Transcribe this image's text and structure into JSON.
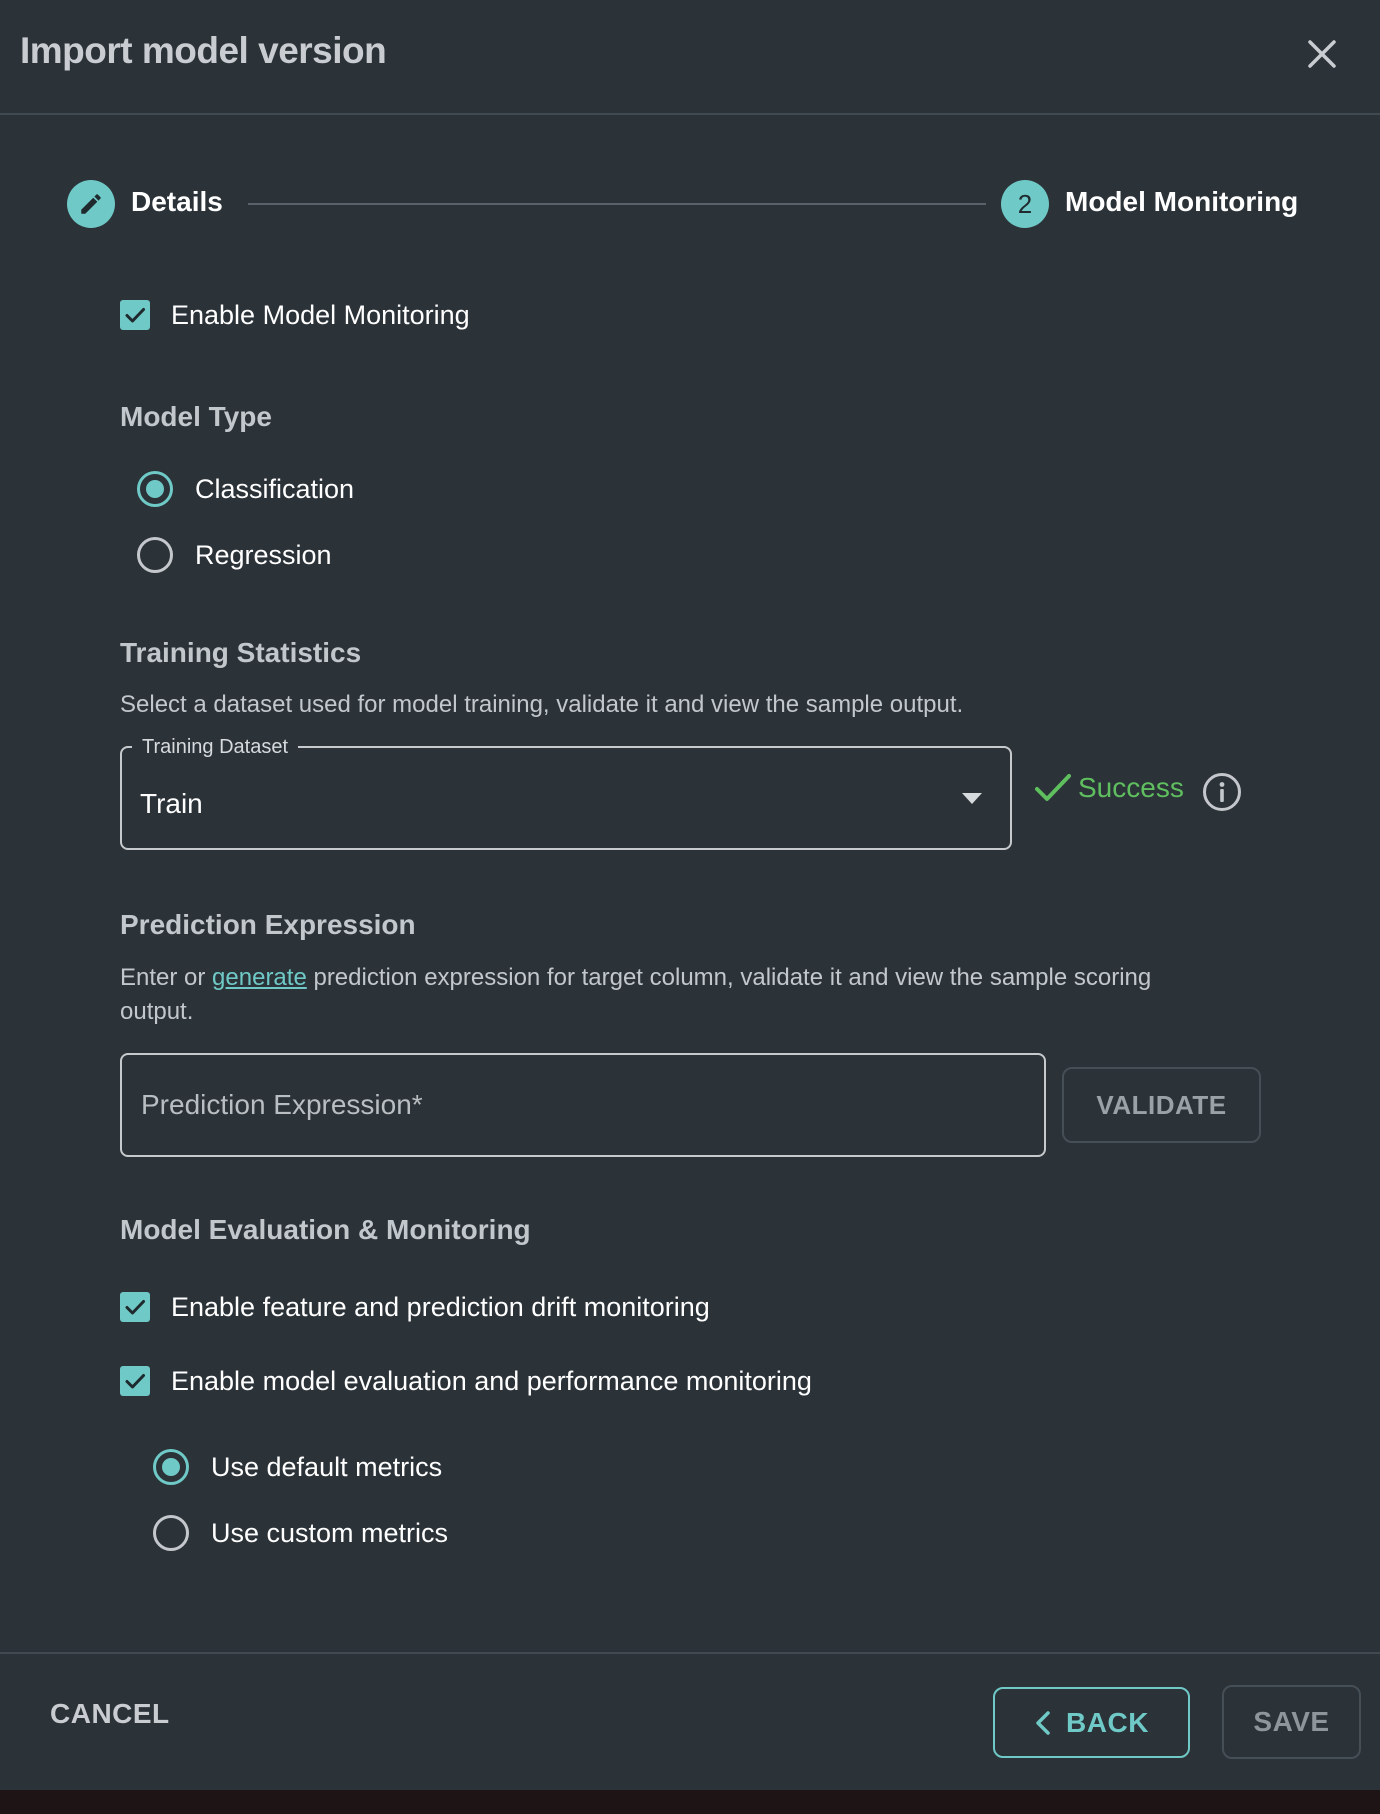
{
  "dialog": {
    "title": "Import model version",
    "close_icon": "close-icon"
  },
  "stepper": {
    "steps": [
      {
        "label": "Details",
        "icon": "pencil-icon",
        "state": "completed"
      },
      {
        "label": "Model Monitoring",
        "number": "2",
        "state": "active"
      }
    ]
  },
  "enable_monitoring": {
    "label": "Enable Model Monitoring",
    "checked": true
  },
  "model_type": {
    "title": "Model Type",
    "options": [
      {
        "label": "Classification",
        "selected": true
      },
      {
        "label": "Regression",
        "selected": false
      }
    ]
  },
  "training_statistics": {
    "title": "Training Statistics",
    "description": "Select a dataset used for model training, validate it and view the sample output.",
    "dataset_label": "Training Dataset",
    "dataset_value": "Train",
    "status": "Success",
    "status_color": "#5fbf5f"
  },
  "prediction_expression": {
    "title": "Prediction Expression",
    "desc_prefix": "Enter or ",
    "desc_link": "generate",
    "desc_suffix": " prediction expression for target column, validate it and view the sample scoring output.",
    "placeholder": "Prediction Expression*",
    "validate_label": "VALIDATE"
  },
  "evaluation": {
    "title": "Model Evaluation & Monitoring",
    "drift_label": "Enable feature and prediction drift monitoring",
    "drift_checked": true,
    "performance_label": "Enable model evaluation and performance monitoring",
    "performance_checked": true,
    "metrics": [
      {
        "label": "Use default metrics",
        "selected": true
      },
      {
        "label": "Use custom metrics",
        "selected": false
      }
    ]
  },
  "footer": {
    "cancel_label": "CANCEL",
    "back_label": "BACK",
    "save_label": "SAVE"
  },
  "colors": {
    "background": "#2b3238",
    "accent": "#6fc9c6",
    "success": "#5fbf5f"
  }
}
